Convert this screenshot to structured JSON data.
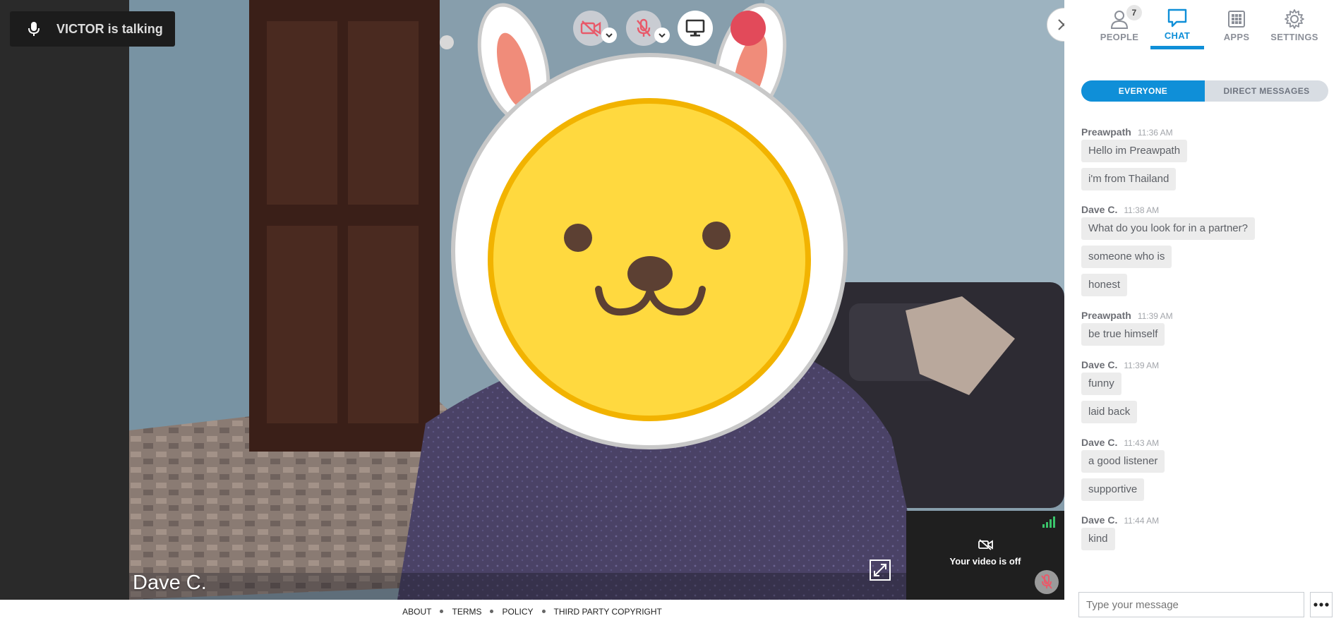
{
  "stage": {
    "talking_label": "VICTOR is talking",
    "participant_name": "Dave C.",
    "self_view_status": "Your video is off"
  },
  "controls": {
    "icons": [
      "video-off-icon",
      "mic-off-icon",
      "screen-share-icon"
    ],
    "accent_muted": "#e85a6a"
  },
  "sidebar": {
    "tabs": [
      {
        "label": "PEOPLE",
        "icon": "people-icon",
        "badge": "7"
      },
      {
        "label": "CHAT",
        "icon": "chat-icon",
        "active": true
      },
      {
        "label": "APPS",
        "icon": "apps-grid-icon"
      },
      {
        "label": "SETTINGS",
        "icon": "gear-icon"
      }
    ],
    "filters": [
      "EVERYONE",
      "DIRECT MESSAGES"
    ],
    "accent": "#0f8fd8",
    "messages": [
      {
        "sender": "Preawpath",
        "time": "11:36 AM",
        "lines": [
          "Hello im Preawpath",
          "i'm from Thailand"
        ]
      },
      {
        "sender": "Dave C.",
        "time": "11:38 AM",
        "lines": [
          "What do you look for in a partner?",
          "someone who is",
          "honest"
        ]
      },
      {
        "sender": "Preawpath",
        "time": "11:39 AM",
        "lines": [
          "be true himself"
        ]
      },
      {
        "sender": "Dave C.",
        "time": "11:39 AM",
        "lines": [
          "funny",
          "laid back"
        ]
      },
      {
        "sender": "Dave C.",
        "time": "11:43 AM",
        "lines": [
          "a good listener",
          "supportive"
        ]
      },
      {
        "sender": "Dave C.",
        "time": "11:44 AM",
        "lines": [
          "kind"
        ]
      }
    ],
    "composer_placeholder": "Type your message"
  },
  "footer": {
    "links": [
      "ABOUT",
      "TERMS",
      "POLICY",
      "THIRD PARTY COPYRIGHT"
    ]
  }
}
